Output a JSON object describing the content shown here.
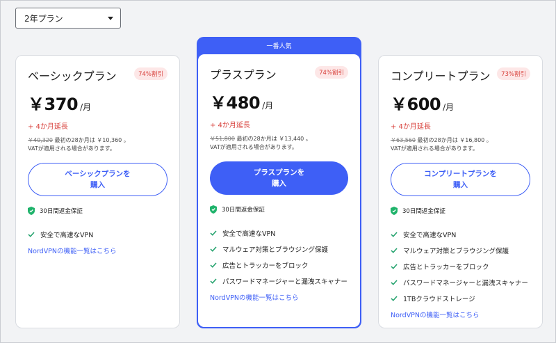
{
  "plan_select": {
    "value": "2年プラン"
  },
  "featured_label": "一番人気",
  "colors": {
    "accent": "#3e5ff6",
    "sale": "#d8403b",
    "badge_bg": "#fde7e7"
  },
  "plans": [
    {
      "title": "ベーシックプラン",
      "discount": "74%割引",
      "price": "￥370",
      "per": "/月",
      "extension": "+ 4か月延長",
      "original_price": "￥40,320",
      "first_term": "最初の28か月は ￥10,360 。",
      "vat_note": "VATが適用される場合があります。",
      "button_line1": "ベーシックプランを",
      "button_line2": "購入",
      "guarantee": "30日間返金保証",
      "features": [
        "安全で高速なVPN"
      ],
      "link": "NordVPNの機能一覧はこちら"
    },
    {
      "title": "プラスプラン",
      "discount": "74%割引",
      "price": "￥480",
      "per": "/月",
      "extension": "+ 4か月延長",
      "original_price": "￥51,800",
      "first_term": "最初の28か月は ￥13,440 。",
      "vat_note": "VATが適用される場合があります。",
      "button_line1": "プラスプランを",
      "button_line2": "購入",
      "guarantee": "30日間返金保証",
      "features": [
        "安全で高速なVPN",
        "マルウェア対策とブラウジング保護",
        "広告とトラッカーをブロック",
        "パスワードマネージャーと漏洩スキャナー"
      ],
      "link": "NordVPNの機能一覧はこちら"
    },
    {
      "title": "コンプリートプラン",
      "discount": "73%割引",
      "price": "￥600",
      "per": "/月",
      "extension": "+ 4か月延長",
      "original_price": "￥63,560",
      "first_term": "最初の28か月は ￥16,800 。",
      "vat_note": "VATが適用される場合があります。",
      "button_line1": "コンプリートプランを",
      "button_line2": "購入",
      "guarantee": "30日間返金保証",
      "features": [
        "安全で高速なVPN",
        "マルウェア対策とブラウジング保護",
        "広告とトラッカーをブロック",
        "パスワードマネージャーと漏洩スキャナー",
        "1TBクラウドストレージ"
      ],
      "link": "NordVPNの機能一覧はこちら"
    }
  ]
}
